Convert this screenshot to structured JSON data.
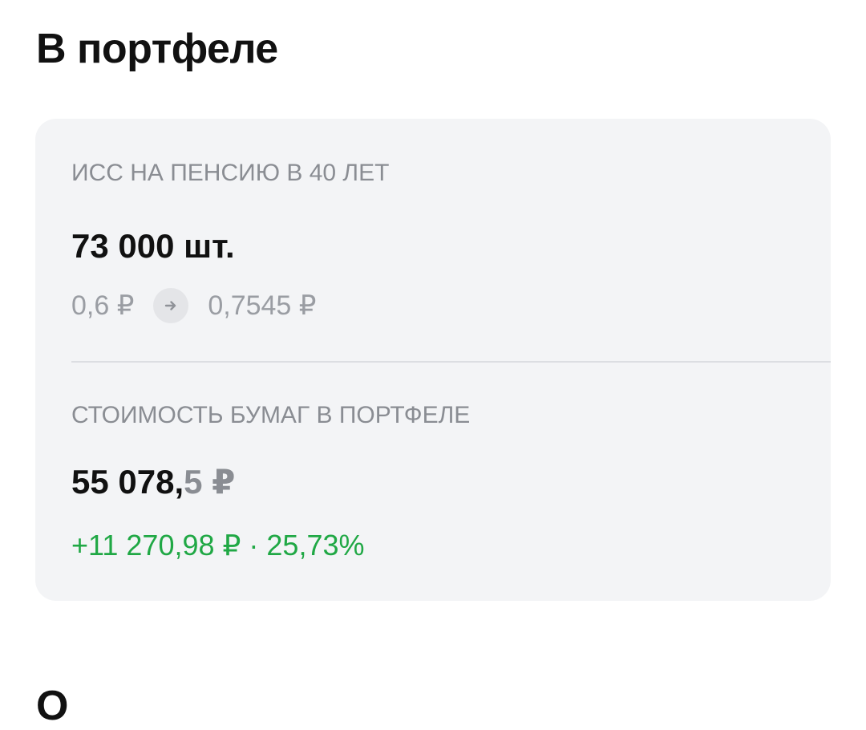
{
  "page": {
    "title": "В портфеле",
    "next_section_peek": "О"
  },
  "holding": {
    "name": "ИСС НА ПЕНСИЮ В 40 ЛЕТ",
    "quantity": "73 000 шт.",
    "buy_price": "0,6 ₽",
    "current_price": "0,7545 ₽",
    "arrow_icon": "arrow-right-icon"
  },
  "portfolio_value": {
    "label": "СТОИМОСТЬ БУМАГ В ПОРТФЕЛЕ",
    "amount_main": "55 078,",
    "amount_fraction": "5 ₽",
    "change": "+11 270,98 ₽ · 25,73%",
    "change_color": "#20a845"
  }
}
